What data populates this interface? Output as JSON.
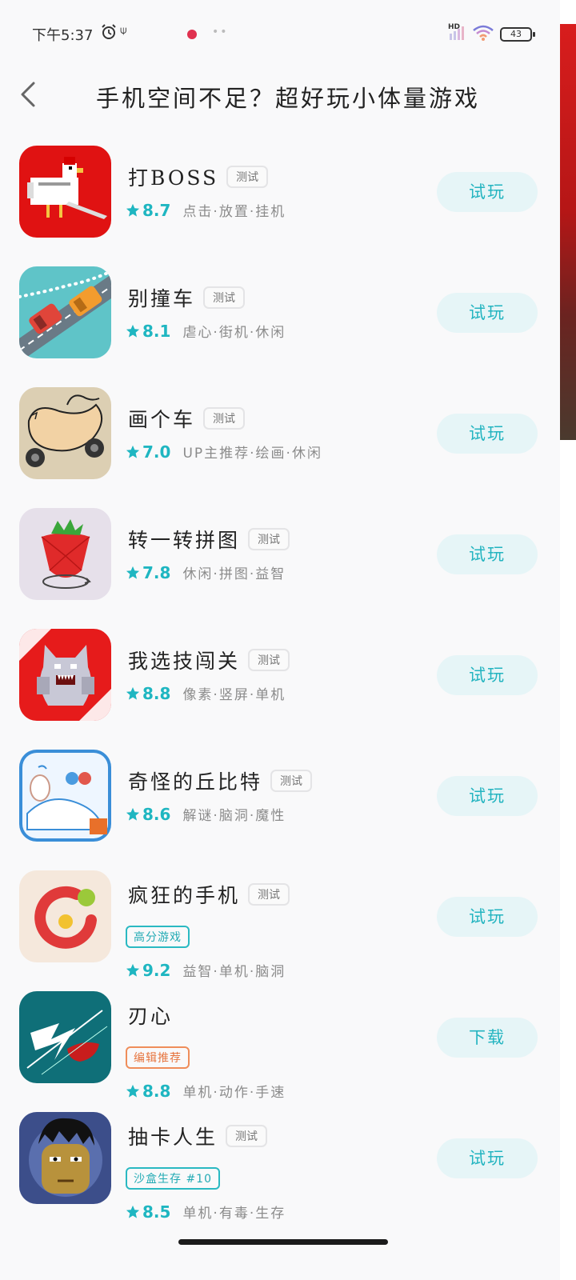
{
  "status_bar": {
    "time": "下午5:37",
    "usb": "⍦",
    "hd": "HD",
    "battery": "43"
  },
  "header": {
    "title": "手机空间不足？超好玩小体量游戏"
  },
  "colors": {
    "accent": "#1fb6c1",
    "button_bg": "#e6f5f7",
    "badge_teal": "#2ab9c2",
    "badge_orange": "#ef8d5a"
  },
  "games": [
    {
      "name": "打BOSS",
      "beta": "测试",
      "badge": "",
      "rating": "8.7",
      "tags": "点击·放置·挂机",
      "action": "试玩",
      "icon": "chicken-game-icon"
    },
    {
      "name": "别撞车",
      "beta": "测试",
      "badge": "",
      "rating": "8.1",
      "tags": "虐心·街机·休闲",
      "action": "试玩",
      "icon": "cars-game-icon"
    },
    {
      "name": "画个车",
      "beta": "测试",
      "badge": "",
      "rating": "7.0",
      "tags": "UP主推荐·绘画·休闲",
      "action": "试玩",
      "icon": "drawn-car-game-icon"
    },
    {
      "name": "转一转拼图",
      "beta": "测试",
      "badge": "",
      "rating": "7.8",
      "tags": "休闲·拼图·益智",
      "action": "试玩",
      "icon": "strawberry-game-icon"
    },
    {
      "name": "我选技闯关",
      "beta": "测试",
      "badge": "",
      "rating": "8.8",
      "tags": "像素·竖屏·单机",
      "action": "试玩",
      "icon": "werewolf-game-icon"
    },
    {
      "name": "奇怪的丘比特",
      "beta": "测试",
      "badge": "",
      "rating": "8.6",
      "tags": "解谜·脑洞·魔性",
      "action": "试玩",
      "icon": "cupid-game-icon"
    },
    {
      "name": "疯狂的手机",
      "beta": "测试",
      "badge": "高分游戏",
      "badge_color": "teal",
      "rating": "9.2",
      "tags": "益智·单机·脑洞",
      "action": "试玩",
      "icon": "crazy-phone-game-icon"
    },
    {
      "name": "刃心",
      "beta": "",
      "badge": "编辑推荐",
      "badge_color": "orange",
      "rating": "8.8",
      "tags": "单机·动作·手速",
      "action": "下载",
      "icon": "blade-heart-game-icon"
    },
    {
      "name": "抽卡人生",
      "beta": "测试",
      "badge": "沙盒生存 #10",
      "badge_color": "teal",
      "rating": "8.5",
      "tags": "单机·有毒·生存",
      "action": "试玩",
      "icon": "gacha-life-game-icon"
    }
  ]
}
